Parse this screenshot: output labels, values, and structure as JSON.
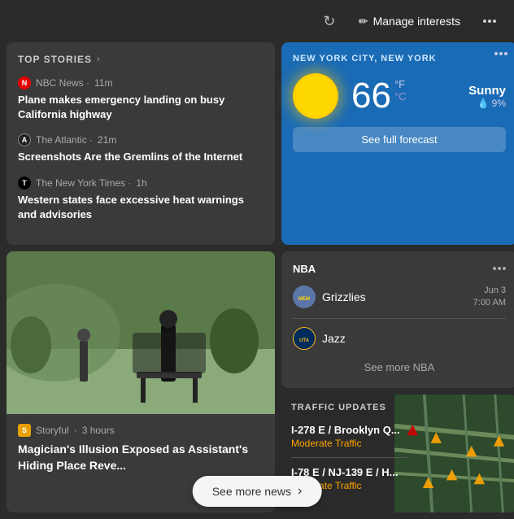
{
  "topbar": {
    "manage_interests": "Manage interests",
    "pencil_icon": "pencil-icon",
    "refresh_icon": "refresh-icon",
    "more_icon": "more-icon"
  },
  "top_stories": {
    "title": "TOP STORIES",
    "chevron": "›",
    "articles": [
      {
        "source": "NBC News",
        "source_abbr": "N",
        "time": "11m",
        "headline": "Plane makes emergency landing on busy California highway"
      },
      {
        "source": "The Atlantic",
        "source_abbr": "A",
        "time": "21m",
        "headline": "Screenshots Are the Gremlins of the Internet"
      },
      {
        "source": "The New York Times",
        "source_abbr": "T",
        "time": "1h",
        "headline": "Western states face excessive heat warnings and advisories"
      }
    ]
  },
  "weather": {
    "location": "NEW YORK CITY, NEW YORK",
    "temperature": "66",
    "unit_f": "°F",
    "unit_c": "°C",
    "condition": "Sunny",
    "precip": "9%",
    "forecast_btn": "See full forecast"
  },
  "nba": {
    "title": "NBA",
    "games": [
      {
        "team": "Grizzlies",
        "date": "Jun 3",
        "time": "7:00 AM"
      },
      {
        "team": "Jazz",
        "date": "",
        "time": ""
      }
    ],
    "see_more": "See more NBA"
  },
  "magician_story": {
    "source": "Storyful",
    "source_abbr": "S",
    "time": "3 hours",
    "headline": "Magician's Illusion Exposed as Assistant's Hiding Place Reve..."
  },
  "traffic": {
    "title": "TRAFFIC UPDATES",
    "routes": [
      {
        "name": "I-278 E / Brooklyn Q...",
        "status": "Moderate Traffic"
      },
      {
        "name": "I-78 E / NJ-139 E / H...",
        "status": "Moderate Traffic"
      }
    ]
  },
  "see_more_news": {
    "label": "See more news",
    "arrow": "›"
  }
}
